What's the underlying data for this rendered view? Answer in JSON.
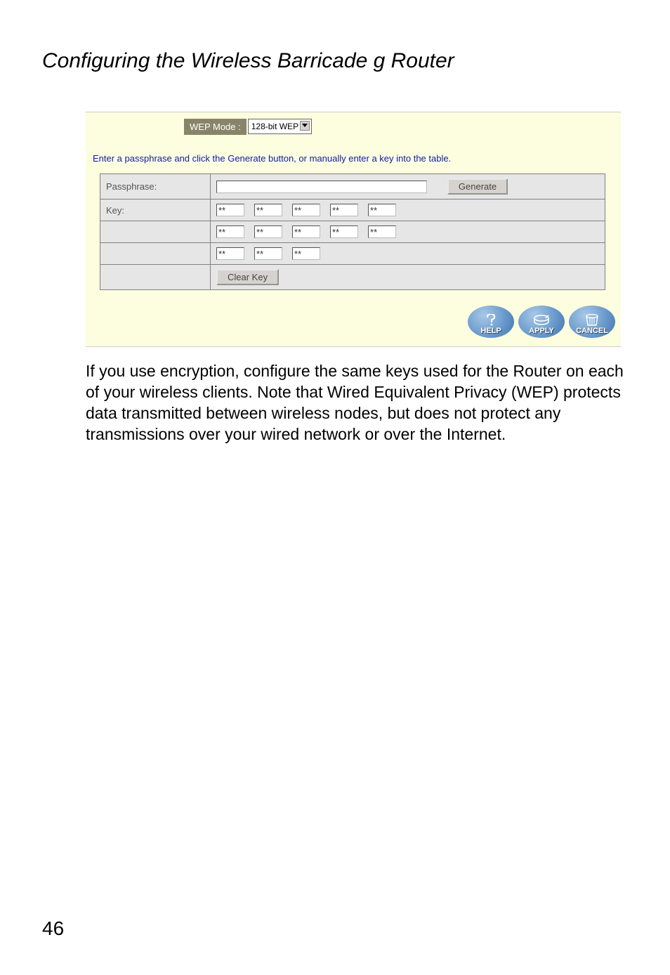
{
  "title": "Configuring the Wireless Barricade g Router",
  "screenshot": {
    "wep_mode_label": "WEP Mode :",
    "wep_mode_value": "128-bit WEP",
    "instruction": "Enter a passphrase and click the Generate button, or manually enter a key into the table.",
    "passphrase_label": "Passphrase:",
    "passphrase_value": "",
    "generate_label": "Generate",
    "key_label": "Key:",
    "key_values_row1": [
      "**",
      "**",
      "**",
      "**",
      "**"
    ],
    "key_values_row2": [
      "**",
      "**",
      "**",
      "**",
      "**"
    ],
    "key_values_row3": [
      "**",
      "**",
      "**"
    ],
    "clear_key_label": "Clear Key",
    "footer": {
      "help": "HELP",
      "apply": "APPLY",
      "cancel": "CANCEL"
    }
  },
  "body_text": "If you use encryption, configure the same keys used for the Router on each of your wireless clients. Note that Wired Equivalent Privacy (WEP) protects data transmitted between wireless nodes, but does not protect any transmissions over your wired network or over the Internet.",
  "page_number": "46"
}
